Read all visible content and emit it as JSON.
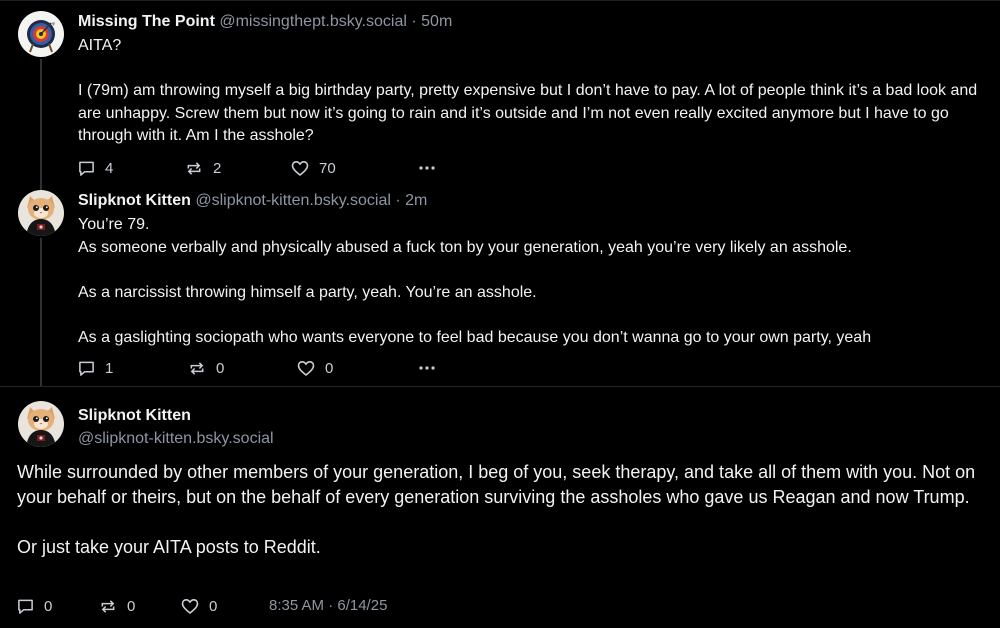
{
  "posts": [
    {
      "author_name": "Missing The Point",
      "author_handle": "@missingthept.bsky.social",
      "separator": "·",
      "time_ago": "50m",
      "paragraphs": [
        "AITA?",
        "I (79m) am throwing myself a big birthday party, pretty expensive but I don’t have to pay. A lot of people think it’s a bad look and are unhappy. Screw them but now it’s going to rain and it’s outside and I’m not even really excited anymore but I have to go through with it. Am I the asshole?"
      ],
      "replies": "4",
      "reposts": "2",
      "likes": "70",
      "avatar_icon": "archery-target-icon"
    },
    {
      "author_name": "Slipknot Kitten",
      "author_handle": "@slipknot-kitten.bsky.social",
      "separator": "·",
      "time_ago": "2m",
      "paragraphs": [
        "You’re 79.",
        "As someone verbally and physically abused a fuck ton by your generation, yeah you’re very likely an asshole.",
        "As a narcissist throwing himself a party, yeah. You’re an asshole.",
        "As a gaslighting sociopath who wants everyone to feel bad because you don’t wanna go to your own party, yeah"
      ],
      "replies": "1",
      "reposts": "0",
      "likes": "0",
      "avatar_icon": "kitten-photo-icon"
    }
  ],
  "main_post": {
    "author_name": "Slipknot Kitten",
    "author_handle": "@slipknot-kitten.bsky.social",
    "paragraphs": [
      "While surrounded by other members of your generation, I beg of you, seek therapy, and take all of them with you. Not on your behalf or theirs, but on the behalf of every generation surviving the assholes who gave us Reagan and now Trump.",
      "Or just take your AITA posts to Reddit."
    ],
    "replies": "0",
    "reposts": "0",
    "likes": "0",
    "timestamp": "8:35 AM · 6/14/25"
  },
  "icons": {
    "reply": "speech-bubble-icon",
    "repost": "repost-arrows-icon",
    "like": "heart-icon",
    "more": "ellipsis-icon"
  },
  "colors": {
    "background": "#000000",
    "text": "#f1f3f5",
    "muted": "#8d96a2",
    "divider": "#26282c"
  }
}
